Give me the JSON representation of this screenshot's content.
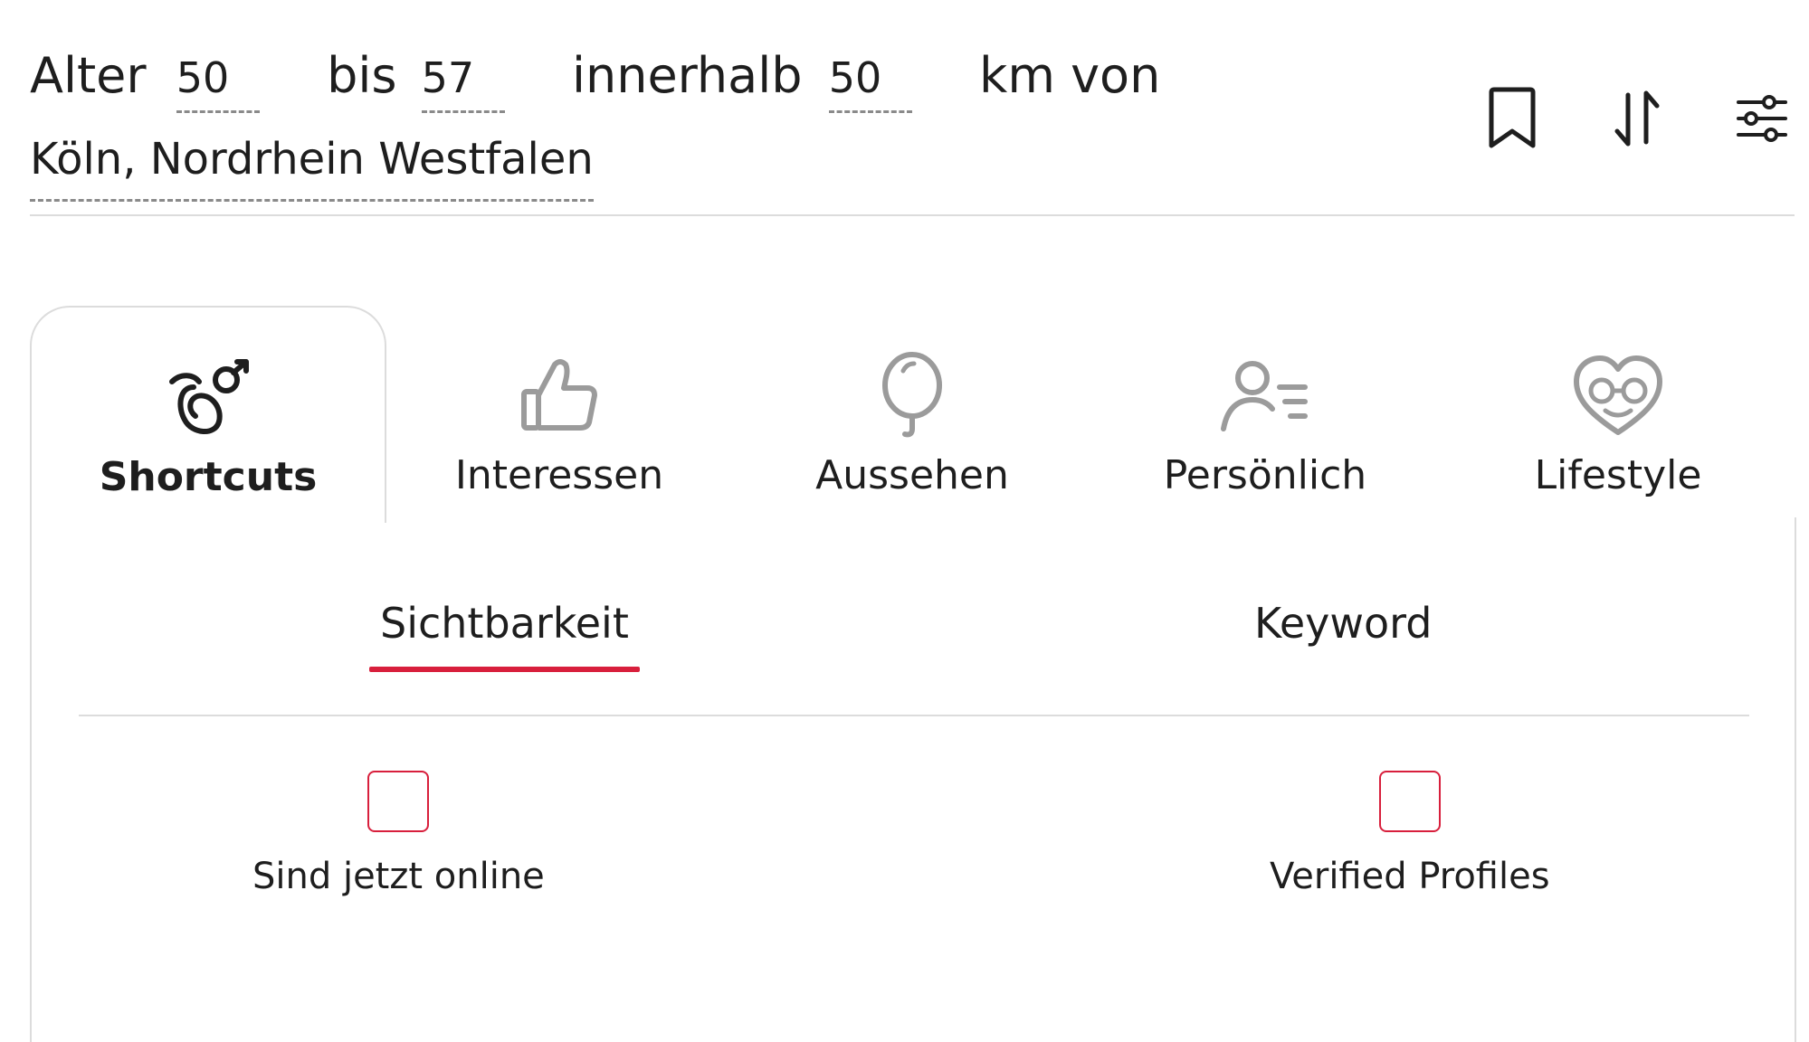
{
  "colors": {
    "accent": "#d81f3c",
    "text": "#1e1e1e",
    "muted_icon": "#9b9b9b",
    "divider": "#dcdcdc"
  },
  "search_summary": {
    "age_label": "Alter",
    "age_from": "50",
    "to_label": "bis",
    "age_to": "57",
    "within_label": "innerhalb",
    "distance": "50",
    "unit_label": "km von",
    "location": "Köln, Nordrhein Westfalen"
  },
  "header_icons": [
    {
      "icon": "bookmark-icon"
    },
    {
      "icon": "sort-icon"
    },
    {
      "icon": "filter-sliders-icon"
    }
  ],
  "tabs": [
    {
      "label": "Shortcuts",
      "icon": "shortcuts-icon",
      "active": true
    },
    {
      "label": "Interessen",
      "icon": "thumbs-up-icon",
      "active": false
    },
    {
      "label": "Aussehen",
      "icon": "mirror-icon",
      "active": false
    },
    {
      "label": "Persönlich",
      "icon": "person-details-icon",
      "active": false
    },
    {
      "label": "Lifestyle",
      "icon": "heart-face-icon",
      "active": false
    }
  ],
  "subtabs": [
    {
      "label": "Sichtbarkeit",
      "active": true
    },
    {
      "label": "Keyword",
      "active": false
    }
  ],
  "checkboxes": [
    {
      "label": "Sind jetzt online",
      "checked": false
    },
    {
      "label": "Verified Profiles",
      "checked": false
    }
  ]
}
